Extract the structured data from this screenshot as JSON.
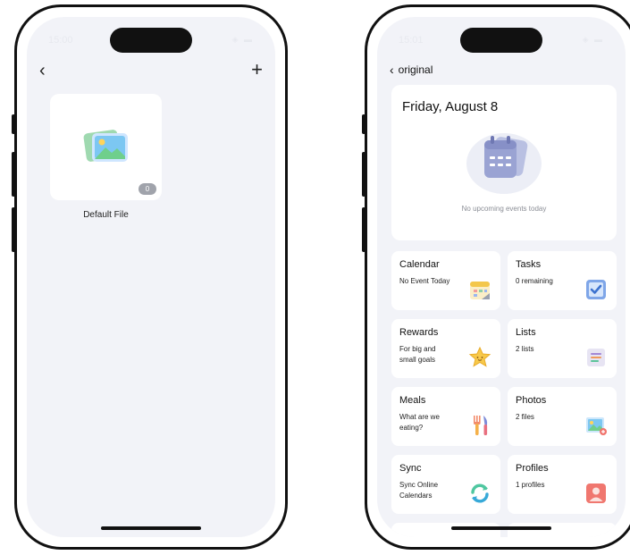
{
  "left_phone": {
    "status": {
      "time": "15:00",
      "icons": "◈ ▬"
    },
    "nav": {
      "back_icon": "chevron-left-icon",
      "add_icon": "plus-icon"
    },
    "album": {
      "title": "Default File",
      "count": "0"
    }
  },
  "right_phone": {
    "status": {
      "time": "15:01",
      "icons": "◈ ▬"
    },
    "nav": {
      "back_label": "original"
    },
    "date_card": {
      "title": "Friday, August 8",
      "empty_text": "No upcoming events today"
    },
    "tiles": [
      {
        "title": "Calendar",
        "subtitle": "No Event Today",
        "icon": "calendar-icon"
      },
      {
        "title": "Tasks",
        "subtitle": "0 remaining",
        "icon": "checkbox-icon"
      },
      {
        "title": "Rewards",
        "subtitle": "For big and small goals",
        "icon": "star-icon"
      },
      {
        "title": "Lists",
        "subtitle": "2 lists",
        "icon": "list-icon"
      },
      {
        "title": "Meals",
        "subtitle": "What are we eating?",
        "icon": "utensils-icon"
      },
      {
        "title": "Photos",
        "subtitle": "2 files",
        "icon": "photo-icon"
      },
      {
        "title": "Sync",
        "subtitle": "Sync Online Calendars",
        "icon": "sync-icon"
      },
      {
        "title": "Profiles",
        "subtitle": "1 profiles",
        "icon": "profile-icon"
      }
    ]
  }
}
